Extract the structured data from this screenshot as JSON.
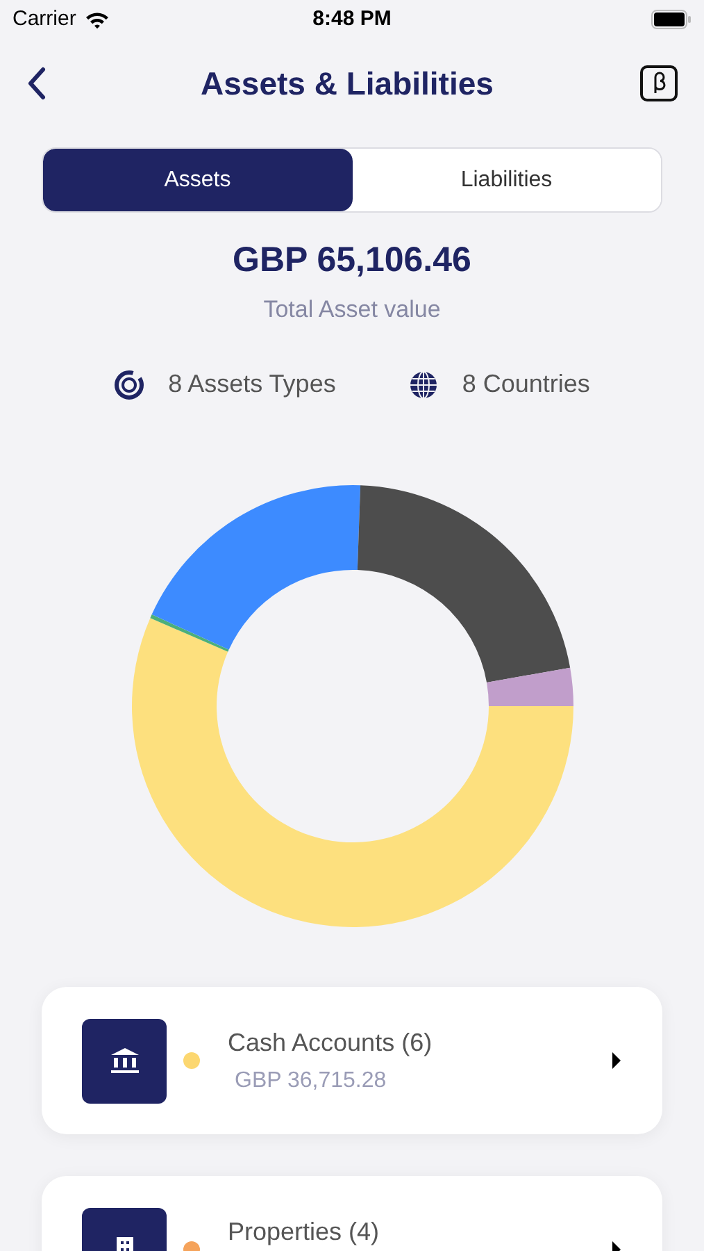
{
  "status_bar": {
    "carrier": "Carrier",
    "time": "8:48 PM"
  },
  "header": {
    "title": "Assets & Liabilities"
  },
  "tabs": [
    {
      "label": "Assets",
      "selected": true
    },
    {
      "label": "Liabilities",
      "selected": false
    }
  ],
  "summary": {
    "total": "GBP 65,106.46",
    "caption": "Total Asset value"
  },
  "stats": [
    {
      "kind": "types",
      "label": "8 Assets Types"
    },
    {
      "kind": "countries",
      "label": "8 Countries"
    }
  ],
  "categories": [
    {
      "kind": "bank",
      "name": "Cash Accounts (6)",
      "amount": "GBP 36,715.28",
      "color": "#fcd770"
    },
    {
      "kind": "building",
      "name": "Properties (4)",
      "color": "#f5a35b"
    }
  ]
}
